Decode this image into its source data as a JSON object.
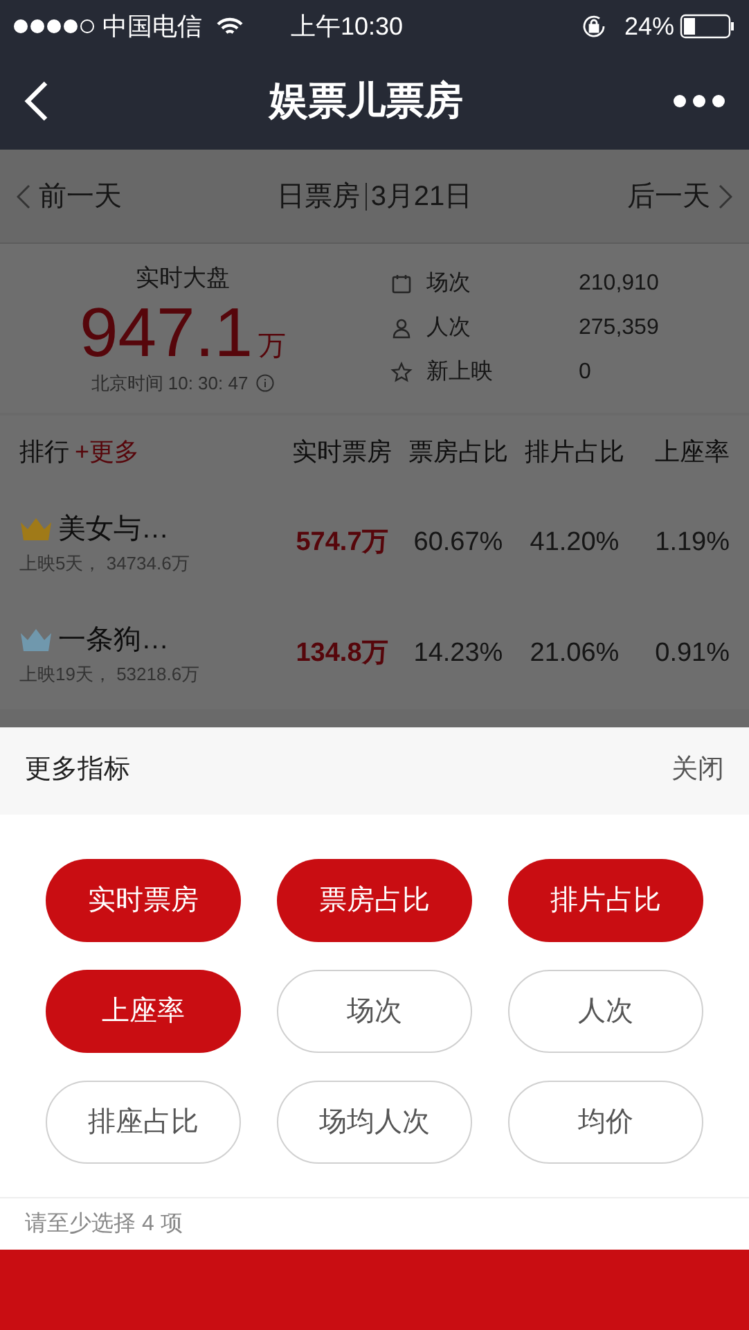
{
  "status_bar": {
    "carrier": "中国电信",
    "time": "上午10:30",
    "battery": "24%"
  },
  "nav": {
    "title": "娱票儿票房"
  },
  "date_bar": {
    "prev": "前一天",
    "title": "日票房",
    "date": "3月21日",
    "next": "后一天"
  },
  "summary": {
    "label": "实时大盘",
    "value": "947.1",
    "unit": "万",
    "time": "北京时间 10: 30: 47",
    "stats": [
      {
        "kind": "calendar",
        "label": "场次",
        "value": "210,910"
      },
      {
        "kind": "person",
        "label": "人次",
        "value": "275,359"
      },
      {
        "kind": "star",
        "label": "新上映",
        "value": "0"
      }
    ]
  },
  "ranking": {
    "title": "排行",
    "more": "+更多",
    "columns": [
      "实时票房",
      "票房占比",
      "排片占比",
      "上座率"
    ],
    "rows": [
      {
        "color": "#a07a18",
        "name": "美女与…",
        "sub": "上映5天， 34734.6万",
        "cells": [
          "574.7万",
          "60.67%",
          "41.20%",
          "1.19%"
        ]
      },
      {
        "color": "#7098ad",
        "name": "一条狗…",
        "sub": "上映19天， 53218.6万",
        "cells": [
          "134.8万",
          "14.23%",
          "21.06%",
          "0.91%"
        ]
      }
    ]
  },
  "sheet": {
    "title": "更多指标",
    "close": "关闭",
    "options": [
      {
        "label": "实时票房",
        "selected": true
      },
      {
        "label": "票房占比",
        "selected": true
      },
      {
        "label": "排片占比",
        "selected": true
      },
      {
        "label": "上座率",
        "selected": true
      },
      {
        "label": "场次",
        "selected": false
      },
      {
        "label": "人次",
        "selected": false
      },
      {
        "label": "排座占比",
        "selected": false
      },
      {
        "label": "场均人次",
        "selected": false
      },
      {
        "label": "均价",
        "selected": false
      }
    ],
    "hint": "请至少选择 4 项"
  }
}
